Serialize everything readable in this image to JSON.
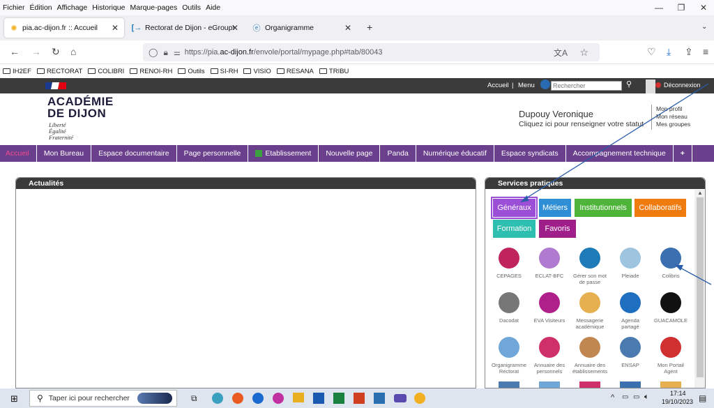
{
  "menubar": {
    "items": [
      "Fichier",
      "Édition",
      "Affichage",
      "Historique",
      "Marque-pages",
      "Outils",
      "Aide"
    ]
  },
  "tabs": [
    {
      "label": "pia.ac-dijon.fr :: Accueil",
      "active": true
    },
    {
      "label": "Rectorat de Dijon - eGroupWare",
      "active": false
    },
    {
      "label": "Organigramme",
      "active": false
    }
  ],
  "url": {
    "prefix": "https://pia.",
    "domain": "ac-dijon.fr",
    "suffix": "/envole/portal/mypage.php#tab/80043"
  },
  "bookmarks": [
    "IH2EF",
    "RECTORAT",
    "COLIBRI",
    "RENOI-RH",
    "Outils",
    "SI-RH",
    "VISIO",
    "RESANA",
    "TRIBU"
  ],
  "topstrip": {
    "accueil": "Accueil",
    "sep": "|",
    "menu": "Menu",
    "search_placeholder": "Rechercher",
    "logout": "Déconnexion"
  },
  "header": {
    "academie1": "ACADÉMIE",
    "academie2": "DE DIJON",
    "motto1": "Liberté",
    "motto2": "Égalité",
    "motto3": "Fraternité",
    "user_name": "Dupouy Veronique",
    "user_hint": "Cliquez ici pour renseigner votre statut",
    "links": [
      "Mon profil",
      "Mon réseau",
      "Mes groupes"
    ]
  },
  "nav": [
    "Accueil",
    "Mon Bureau",
    "Espace documentaire",
    "Page personnelle",
    "Etablissement",
    "Nouvelle page",
    "Panda",
    "Numérique éducatif",
    "Espace syndicats",
    "Accompagnement technique",
    "+"
  ],
  "actualites": {
    "title": "Actualités"
  },
  "services": {
    "title": "Services pratiques",
    "categories": [
      {
        "label": "Généraux",
        "color": "#9b4fd6"
      },
      {
        "label": "Métiers",
        "color": "#2f8fd6"
      },
      {
        "label": "Institutionnels",
        "color": "#4fb53a"
      },
      {
        "label": "Collaboratifs",
        "color": "#f07c10"
      },
      {
        "label": "Formation",
        "color": "#2fbfb0"
      },
      {
        "label": "Favoris",
        "color": "#a01e8a"
      }
    ],
    "items": [
      {
        "label": "CEPAGES",
        "color": "#c0245c"
      },
      {
        "label": "ECLAT-BFC",
        "color": "#b07ad0"
      },
      {
        "label": "Gérer son mot de passe",
        "color": "#1f7ab8"
      },
      {
        "label": "Pleiade",
        "color": "#9ec4e0"
      },
      {
        "label": "Colibris",
        "color": "#3a6fb0"
      },
      {
        "label": "Dacodat",
        "color": "#777777"
      },
      {
        "label": "EVA Visiteurs",
        "color": "#b0208a"
      },
      {
        "label": "Messagerie académique",
        "color": "#e6b050"
      },
      {
        "label": "Agenda partagé",
        "color": "#1f6fc0"
      },
      {
        "label": "GUACAMOLE",
        "color": "#111111"
      },
      {
        "label": "Organigramme Rectorat",
        "color": "#6fa8d8"
      },
      {
        "label": "Annuaire des personnels",
        "color": "#d0306a"
      },
      {
        "label": "Annuaire des établissements",
        "color": "#c08850"
      },
      {
        "label": "ENSAP",
        "color": "#4a7ab0"
      },
      {
        "label": "Mon Portail Agent",
        "color": "#d03030"
      }
    ]
  },
  "taskbar": {
    "search_placeholder": "Taper ici pour rechercher",
    "time": "17:14",
    "date": "19/10/2023"
  }
}
